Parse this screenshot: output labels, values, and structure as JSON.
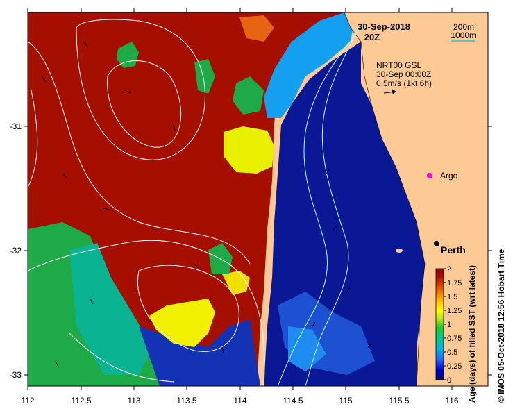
{
  "header": {
    "date": "30-Sep-2018",
    "time": "20Z",
    "contour_legend": [
      "200m",
      "1000m"
    ],
    "product": "NRT00 GSL",
    "product_time": "30-Sep 00:00Z",
    "scale_text": "0.5m/s (1kt 6h)"
  },
  "markers": {
    "argo_label": "Argo",
    "city_label": "Perth"
  },
  "axes": {
    "x_ticks": [
      "112",
      "112.5",
      "113",
      "113.5",
      "114",
      "114.5",
      "115",
      "115.5",
      "116"
    ],
    "y_ticks": [
      "-31",
      "-32",
      "-33"
    ]
  },
  "colorbar": {
    "ticks": [
      "2",
      "1.75",
      "1.5",
      "1.25",
      "1",
      "0.75",
      "0.5",
      "0.25",
      "0"
    ],
    "label": "Age (days) of filled SST (wrt latest)",
    "stops": [
      "#000080",
      "#0000d0",
      "#1e64ff",
      "#00b4e6",
      "#00c890",
      "#1ec832",
      "#b4e61e",
      "#ffff00",
      "#ffb400",
      "#e65a00",
      "#aa1400",
      "#8c0000"
    ]
  },
  "credit": "© IMOS 05-Oct-2018 12:56 Hobart Time",
  "colors": {
    "land": "#fdca96",
    "deep_red": "#a50f00",
    "green": "#1eaa46",
    "teal": "#0ab493",
    "yellow": "#f0f000",
    "cyan": "#14a0f0",
    "blue": "#1432b4",
    "navy": "#0a1896",
    "contour": "#c8ffff"
  }
}
